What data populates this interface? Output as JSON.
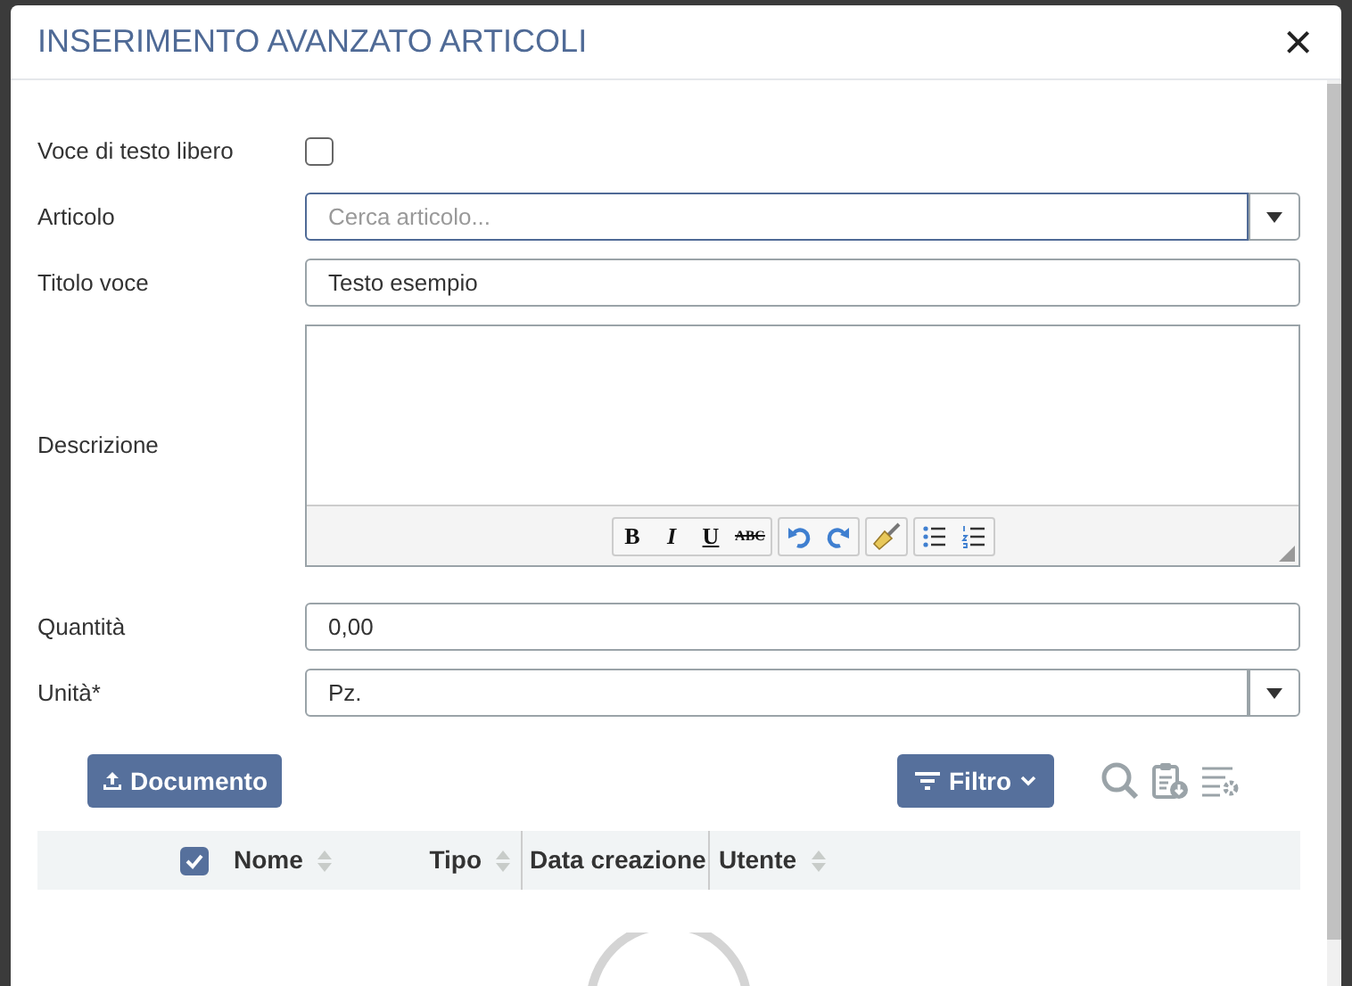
{
  "dialog": {
    "title": "INSERIMENTO AVANZATO ARTICOLI",
    "close": "×",
    "fields": [
      {
        "kind": "checkbox",
        "label": "Voce di testo libero",
        "checked": false
      },
      {
        "kind": "select",
        "label": "Articolo",
        "placeholder": "Cerca articolo...",
        "focused": true
      },
      {
        "kind": "text",
        "label": "Titolo voce",
        "value": "Testo esempio",
        "focused": false
      },
      {
        "kind": "editor",
        "label": "Descrizione",
        "toolbar": [
          [
            {
              "kind": "bold",
              "label": "B"
            },
            {
              "kind": "italic",
              "label": "I"
            },
            {
              "kind": "underline",
              "label": "U"
            },
            {
              "kind": "strike",
              "label": "ABC"
            }
          ],
          [
            {
              "kind": "undo"
            },
            {
              "kind": "redo"
            }
          ],
          [
            {
              "kind": "brush"
            }
          ],
          [
            {
              "kind": "bullets"
            },
            {
              "kind": "numbers"
            }
          ]
        ]
      },
      {
        "kind": "text",
        "label": "Quantità",
        "value": "0,00",
        "focused": false
      },
      {
        "kind": "select",
        "label": "Unità*",
        "value": "Pz.",
        "focused": false
      }
    ],
    "upload_button": "Documento",
    "filter_button": "Filtro",
    "table": {
      "select_all": true,
      "columns": [
        {
          "label": "Nome",
          "sortable": true
        },
        {
          "label": "Tipo",
          "sortable": true
        },
        {
          "label": "Data creazione",
          "sortable": false
        },
        {
          "label": "Utente",
          "sortable": true
        }
      ]
    },
    "loading": true
  }
}
